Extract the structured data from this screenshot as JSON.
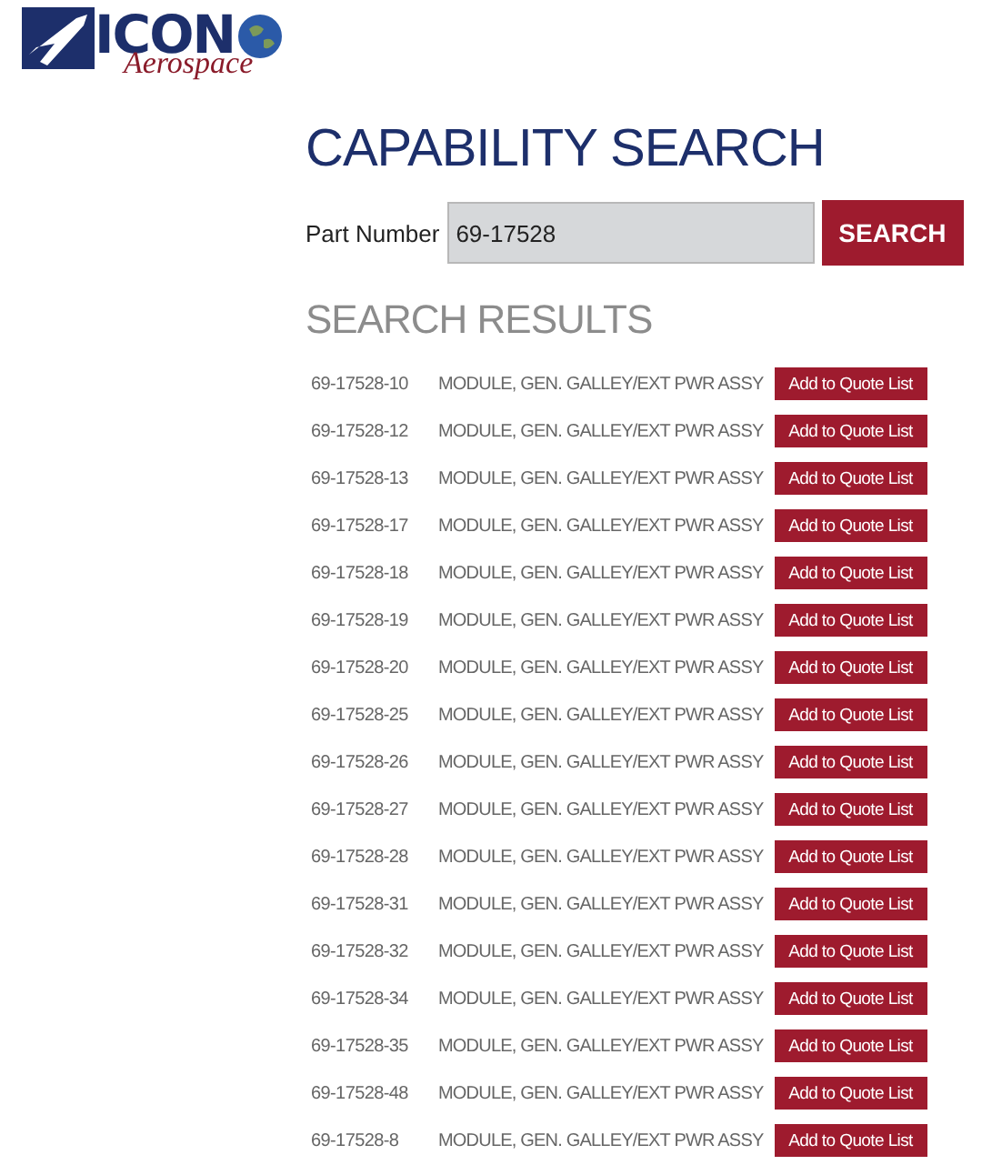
{
  "logo": {
    "name": "ICON",
    "tagline": "Aerospace"
  },
  "title": "CAPABILITY SEARCH",
  "search": {
    "label": "Part Number",
    "value": "69-17528",
    "button": "SEARCH"
  },
  "results_heading": "SEARCH RESULTS",
  "results": [
    {
      "part": "69-17528-10",
      "description": "MODULE, GEN. GALLEY/EXT PWR ASSY",
      "action": "Add to Quote List"
    },
    {
      "part": "69-17528-12",
      "description": "MODULE, GEN. GALLEY/EXT PWR ASSY",
      "action": "Add to Quote List"
    },
    {
      "part": "69-17528-13",
      "description": "MODULE, GEN. GALLEY/EXT PWR ASSY",
      "action": "Add to Quote List"
    },
    {
      "part": "69-17528-17",
      "description": "MODULE, GEN. GALLEY/EXT PWR ASSY",
      "action": "Add to Quote List"
    },
    {
      "part": "69-17528-18",
      "description": "MODULE, GEN. GALLEY/EXT PWR ASSY",
      "action": "Add to Quote List"
    },
    {
      "part": "69-17528-19",
      "description": "MODULE, GEN. GALLEY/EXT PWR ASSY",
      "action": "Add to Quote List"
    },
    {
      "part": "69-17528-20",
      "description": "MODULE, GEN. GALLEY/EXT PWR ASSY",
      "action": "Add to Quote List"
    },
    {
      "part": "69-17528-25",
      "description": "MODULE, GEN. GALLEY/EXT PWR ASSY",
      "action": "Add to Quote List"
    },
    {
      "part": "69-17528-26",
      "description": "MODULE, GEN. GALLEY/EXT PWR ASSY",
      "action": "Add to Quote List"
    },
    {
      "part": "69-17528-27",
      "description": "MODULE, GEN. GALLEY/EXT PWR ASSY",
      "action": "Add to Quote List"
    },
    {
      "part": "69-17528-28",
      "description": "MODULE, GEN. GALLEY/EXT PWR ASSY",
      "action": "Add to Quote List"
    },
    {
      "part": "69-17528-31",
      "description": "MODULE, GEN. GALLEY/EXT PWR ASSY",
      "action": "Add to Quote List"
    },
    {
      "part": "69-17528-32",
      "description": "MODULE, GEN. GALLEY/EXT PWR ASSY",
      "action": "Add to Quote List"
    },
    {
      "part": "69-17528-34",
      "description": "MODULE, GEN. GALLEY/EXT PWR ASSY",
      "action": "Add to Quote List"
    },
    {
      "part": "69-17528-35",
      "description": "MODULE, GEN. GALLEY/EXT PWR ASSY",
      "action": "Add to Quote List"
    },
    {
      "part": "69-17528-48",
      "description": "MODULE, GEN. GALLEY/EXT PWR ASSY",
      "action": "Add to Quote List"
    },
    {
      "part": "69-17528-8",
      "description": "MODULE, GEN. GALLEY/EXT PWR ASSY",
      "action": "Add to Quote List"
    }
  ]
}
